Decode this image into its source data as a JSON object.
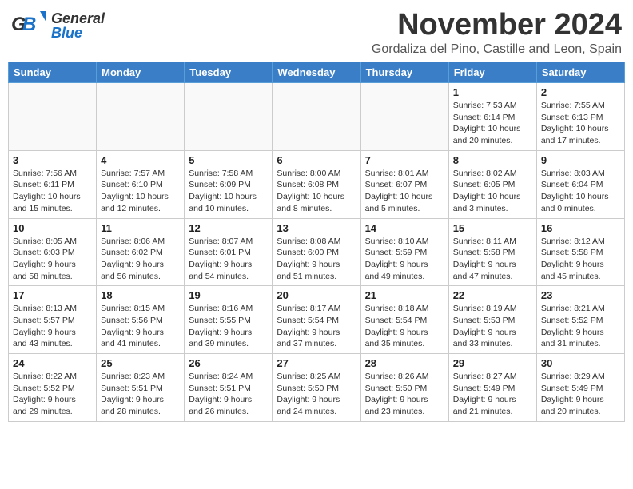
{
  "header": {
    "logo_line1": "General",
    "logo_line2": "Blue",
    "month": "November 2024",
    "location": "Gordaliza del Pino, Castille and Leon, Spain"
  },
  "weekdays": [
    "Sunday",
    "Monday",
    "Tuesday",
    "Wednesday",
    "Thursday",
    "Friday",
    "Saturday"
  ],
  "weeks": [
    [
      {
        "day": "",
        "info": ""
      },
      {
        "day": "",
        "info": ""
      },
      {
        "day": "",
        "info": ""
      },
      {
        "day": "",
        "info": ""
      },
      {
        "day": "",
        "info": ""
      },
      {
        "day": "1",
        "info": "Sunrise: 7:53 AM\nSunset: 6:14 PM\nDaylight: 10 hours\nand 20 minutes."
      },
      {
        "day": "2",
        "info": "Sunrise: 7:55 AM\nSunset: 6:13 PM\nDaylight: 10 hours\nand 17 minutes."
      }
    ],
    [
      {
        "day": "3",
        "info": "Sunrise: 7:56 AM\nSunset: 6:11 PM\nDaylight: 10 hours\nand 15 minutes."
      },
      {
        "day": "4",
        "info": "Sunrise: 7:57 AM\nSunset: 6:10 PM\nDaylight: 10 hours\nand 12 minutes."
      },
      {
        "day": "5",
        "info": "Sunrise: 7:58 AM\nSunset: 6:09 PM\nDaylight: 10 hours\nand 10 minutes."
      },
      {
        "day": "6",
        "info": "Sunrise: 8:00 AM\nSunset: 6:08 PM\nDaylight: 10 hours\nand 8 minutes."
      },
      {
        "day": "7",
        "info": "Sunrise: 8:01 AM\nSunset: 6:07 PM\nDaylight: 10 hours\nand 5 minutes."
      },
      {
        "day": "8",
        "info": "Sunrise: 8:02 AM\nSunset: 6:05 PM\nDaylight: 10 hours\nand 3 minutes."
      },
      {
        "day": "9",
        "info": "Sunrise: 8:03 AM\nSunset: 6:04 PM\nDaylight: 10 hours\nand 0 minutes."
      }
    ],
    [
      {
        "day": "10",
        "info": "Sunrise: 8:05 AM\nSunset: 6:03 PM\nDaylight: 9 hours\nand 58 minutes."
      },
      {
        "day": "11",
        "info": "Sunrise: 8:06 AM\nSunset: 6:02 PM\nDaylight: 9 hours\nand 56 minutes."
      },
      {
        "day": "12",
        "info": "Sunrise: 8:07 AM\nSunset: 6:01 PM\nDaylight: 9 hours\nand 54 minutes."
      },
      {
        "day": "13",
        "info": "Sunrise: 8:08 AM\nSunset: 6:00 PM\nDaylight: 9 hours\nand 51 minutes."
      },
      {
        "day": "14",
        "info": "Sunrise: 8:10 AM\nSunset: 5:59 PM\nDaylight: 9 hours\nand 49 minutes."
      },
      {
        "day": "15",
        "info": "Sunrise: 8:11 AM\nSunset: 5:58 PM\nDaylight: 9 hours\nand 47 minutes."
      },
      {
        "day": "16",
        "info": "Sunrise: 8:12 AM\nSunset: 5:58 PM\nDaylight: 9 hours\nand 45 minutes."
      }
    ],
    [
      {
        "day": "17",
        "info": "Sunrise: 8:13 AM\nSunset: 5:57 PM\nDaylight: 9 hours\nand 43 minutes."
      },
      {
        "day": "18",
        "info": "Sunrise: 8:15 AM\nSunset: 5:56 PM\nDaylight: 9 hours\nand 41 minutes."
      },
      {
        "day": "19",
        "info": "Sunrise: 8:16 AM\nSunset: 5:55 PM\nDaylight: 9 hours\nand 39 minutes."
      },
      {
        "day": "20",
        "info": "Sunrise: 8:17 AM\nSunset: 5:54 PM\nDaylight: 9 hours\nand 37 minutes."
      },
      {
        "day": "21",
        "info": "Sunrise: 8:18 AM\nSunset: 5:54 PM\nDaylight: 9 hours\nand 35 minutes."
      },
      {
        "day": "22",
        "info": "Sunrise: 8:19 AM\nSunset: 5:53 PM\nDaylight: 9 hours\nand 33 minutes."
      },
      {
        "day": "23",
        "info": "Sunrise: 8:21 AM\nSunset: 5:52 PM\nDaylight: 9 hours\nand 31 minutes."
      }
    ],
    [
      {
        "day": "24",
        "info": "Sunrise: 8:22 AM\nSunset: 5:52 PM\nDaylight: 9 hours\nand 29 minutes."
      },
      {
        "day": "25",
        "info": "Sunrise: 8:23 AM\nSunset: 5:51 PM\nDaylight: 9 hours\nand 28 minutes."
      },
      {
        "day": "26",
        "info": "Sunrise: 8:24 AM\nSunset: 5:51 PM\nDaylight: 9 hours\nand 26 minutes."
      },
      {
        "day": "27",
        "info": "Sunrise: 8:25 AM\nSunset: 5:50 PM\nDaylight: 9 hours\nand 24 minutes."
      },
      {
        "day": "28",
        "info": "Sunrise: 8:26 AM\nSunset: 5:50 PM\nDaylight: 9 hours\nand 23 minutes."
      },
      {
        "day": "29",
        "info": "Sunrise: 8:27 AM\nSunset: 5:49 PM\nDaylight: 9 hours\nand 21 minutes."
      },
      {
        "day": "30",
        "info": "Sunrise: 8:29 AM\nSunset: 5:49 PM\nDaylight: 9 hours\nand 20 minutes."
      }
    ]
  ]
}
